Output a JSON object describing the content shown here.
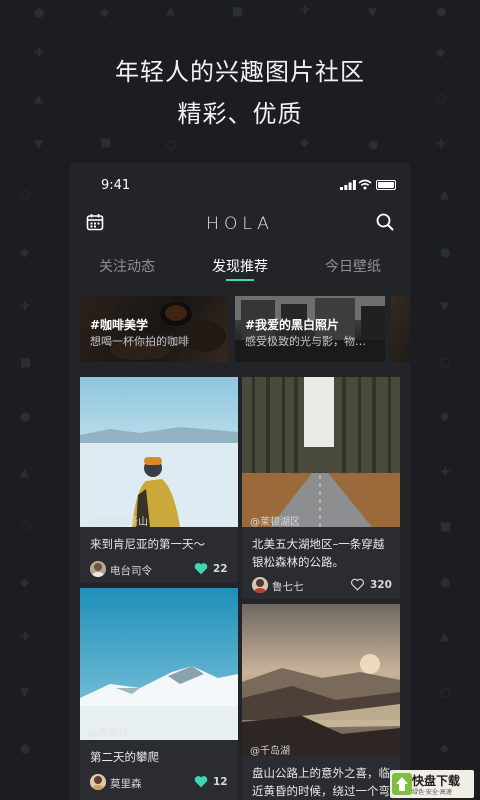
{
  "promo": {
    "line1": "年轻人的兴趣图片社区",
    "line2": "精彩、优质"
  },
  "status_bar": {
    "time": "9:41"
  },
  "app_bar": {
    "logo": "HOLA",
    "left_icon": "calendar-icon",
    "right_icon": "search-icon"
  },
  "tabs": [
    {
      "label": "关注动态",
      "active": false
    },
    {
      "label": "发现推荐",
      "active": true
    },
    {
      "label": "今日壁纸",
      "active": false
    }
  ],
  "topics": [
    {
      "title": "#咖啡美学",
      "subtitle": "想喝一杯你拍的咖啡"
    },
    {
      "title": "#我爱的黑白照片",
      "subtitle": "感受极致的光与影，物…"
    }
  ],
  "cards": [
    {
      "location": "@斯特罗斯山",
      "caption": "来到肯尼亚的第一天～",
      "author": "电台司令",
      "likes": "22",
      "liked": true
    },
    {
      "location": "@莱顿湖区",
      "caption": "北美五大湖地区–一条穿越银松森林的公路。",
      "author": "鲁七七",
      "likes": "320",
      "liked": false
    },
    {
      "location": "@唐吉拉",
      "caption": "第二天的攀爬",
      "author": "莫里森",
      "likes": "12",
      "liked": true
    },
    {
      "location": "@千岛湖",
      "caption": "盘山公路上的意外之喜，临近黄昏的时候，绕过一个弯",
      "author": "",
      "likes": "",
      "liked": false
    }
  ],
  "colors": {
    "accent": "#3ed6b3",
    "background": "#1b1d22",
    "card": "#2a2c31"
  },
  "watermark": {
    "text": "快盘下载",
    "sub": "绿色·安全·高速"
  }
}
